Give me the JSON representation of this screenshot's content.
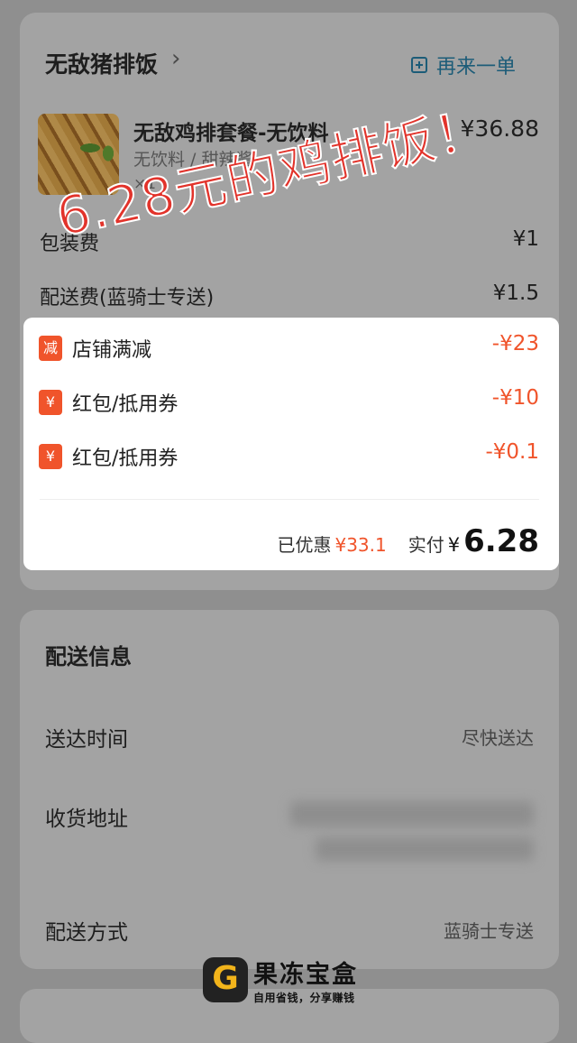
{
  "colors": {
    "accent": "#f0542b",
    "link": "#1c5c78",
    "stamp": "#e2332b"
  },
  "store": {
    "name": "无敌猪排饭",
    "chevron": "›",
    "reorder_label": "再来一单",
    "reorder_icon": "plus-square-icon"
  },
  "item": {
    "name": "无敌鸡排套餐-无饮料",
    "spec": "无饮料 / 甜辣酱",
    "qty": "×1",
    "price": "¥36.88",
    "image": "chicken-cutlet-photo"
  },
  "fees": [
    {
      "label": "包装费",
      "value": "¥1"
    },
    {
      "label": "配送费(蓝骑士专送)",
      "value": "¥1.5"
    }
  ],
  "overlay_text": "6.28元的鸡排饭！",
  "discounts": [
    {
      "badge": "减",
      "label": "店铺满减",
      "amount": "-¥23"
    },
    {
      "badge": "¥",
      "label": "红包/抵用券",
      "amount": "-¥10"
    },
    {
      "badge": "¥",
      "label": "红包/抵用券",
      "amount": "-¥0.1"
    }
  ],
  "summary": {
    "saved_label": "已优惠",
    "saved_value": "¥33.1",
    "paid_label": "实付",
    "paid_symbol": "¥",
    "paid_value": "6.28"
  },
  "delivery": {
    "title": "配送信息",
    "rows": [
      {
        "label": "送达时间",
        "value": "尽快送达"
      },
      {
        "label": "收货地址",
        "value": ""
      },
      {
        "label": "配送方式",
        "value": "蓝骑士专送"
      }
    ]
  },
  "watermark": {
    "title": "果冻宝盒",
    "subtitle": "自用省钱，分享赚钱",
    "logo_letter": "G"
  }
}
